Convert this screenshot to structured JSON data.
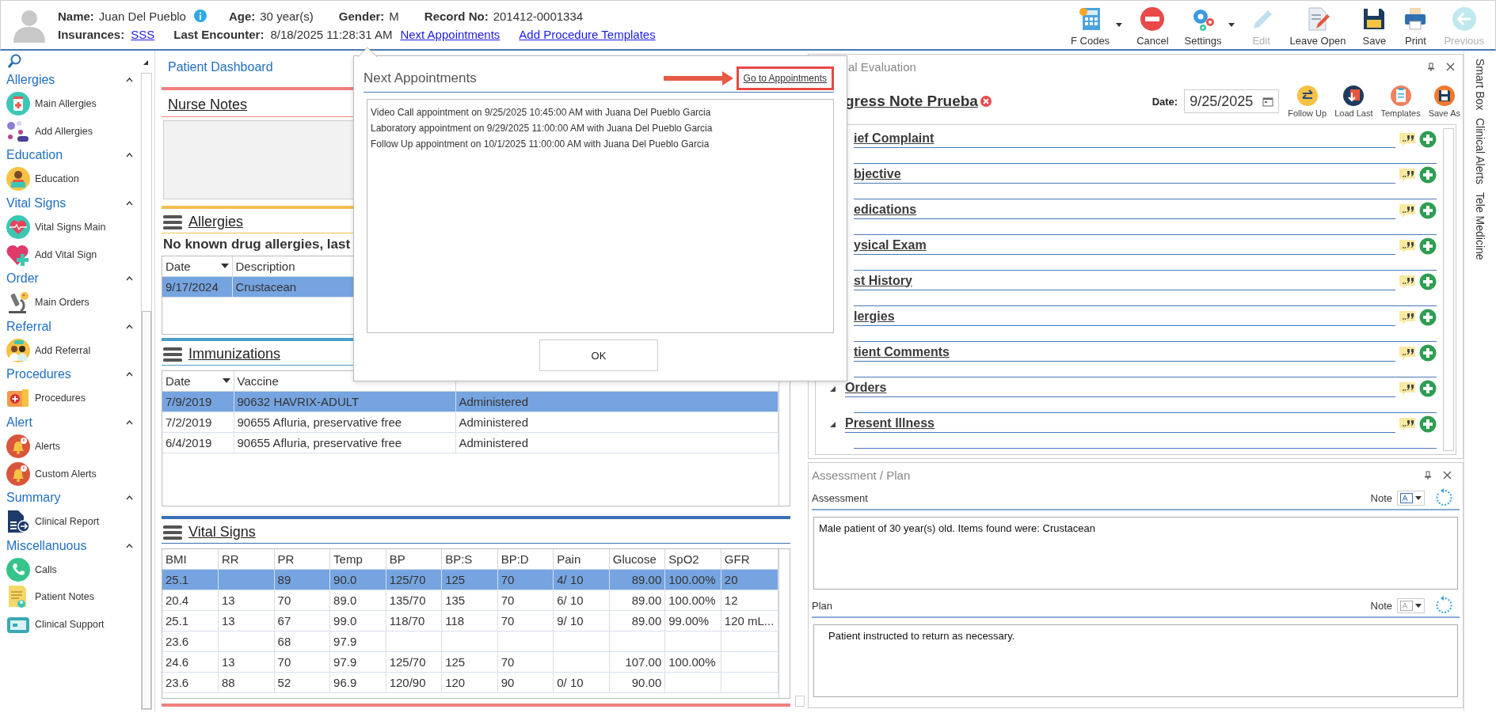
{
  "header": {
    "fields": [
      {
        "label": "Name:",
        "value": "Juan Del Pueblo"
      },
      {
        "label": "Age:",
        "value": "30 year(s)"
      },
      {
        "label": "Gender:",
        "value": "M"
      },
      {
        "label": "Record No:",
        "value": "201412-0001334"
      }
    ],
    "line2": [
      {
        "kind": "label",
        "text": "Insurances:"
      },
      {
        "kind": "link",
        "text": "SSS"
      },
      {
        "kind": "label",
        "text": "Last Encounter:"
      },
      {
        "kind": "value",
        "text": "8/18/2025 11:28:31 AM"
      },
      {
        "kind": "link",
        "text": "Next Appointments"
      },
      {
        "kind": "link",
        "text": "Add Procedure Templates"
      }
    ]
  },
  "toolbar": [
    {
      "label": "F Codes",
      "dropdown": true,
      "disabled": false
    },
    {
      "label": "Cancel",
      "dropdown": false,
      "disabled": false
    },
    {
      "label": "Settings",
      "dropdown": true,
      "disabled": false
    },
    {
      "label": "Edit",
      "dropdown": false,
      "disabled": true
    },
    {
      "label": "Leave Open",
      "dropdown": false,
      "disabled": false
    },
    {
      "label": "Save",
      "dropdown": false,
      "disabled": false
    },
    {
      "label": "Print",
      "dropdown": false,
      "disabled": false
    },
    {
      "label": "Previous",
      "dropdown": false,
      "disabled": true
    }
  ],
  "sidebar": {
    "groups": [
      {
        "title": "Allergies",
        "expanded": true,
        "items": [
          "Main Allergies",
          "Add Allergies"
        ]
      },
      {
        "title": "Education",
        "expanded": true,
        "items": [
          "Education"
        ]
      },
      {
        "title": "Vital Signs",
        "expanded": true,
        "items": [
          "Vital Signs Main",
          "Add Vital Sign"
        ]
      },
      {
        "title": "Order",
        "expanded": true,
        "items": [
          "Main Orders"
        ]
      },
      {
        "title": "Referral",
        "expanded": true,
        "items": [
          "Add Referral"
        ]
      },
      {
        "title": "Procedures",
        "expanded": true,
        "items": [
          "Procedures"
        ]
      },
      {
        "title": "Alert",
        "expanded": true,
        "items": [
          "Alerts",
          "Custom Alerts"
        ]
      },
      {
        "title": "Summary",
        "expanded": true,
        "items": [
          "Clinical Report"
        ]
      },
      {
        "title": "Miscellanuous",
        "expanded": true,
        "items": [
          "Calls",
          "Patient Notes",
          "Clinical Support"
        ]
      }
    ]
  },
  "dashboard": {
    "title": "Patient Dashboard",
    "nurse_notes": {
      "title": "Nurse Notes"
    },
    "allergies": {
      "title": "Allergies",
      "summary": "No known drug allergies, last",
      "columns": [
        {
          "label": "Date",
          "filter": true
        },
        {
          "label": "Description",
          "filter": false
        }
      ],
      "rows": [
        {
          "cells": [
            "9/17/2024",
            "Crustacean"
          ],
          "selected": true
        }
      ]
    },
    "immunizations": {
      "title": "Immunizations",
      "columns": [
        {
          "label": "Date",
          "filter": true
        },
        {
          "label": "Vaccine",
          "filter": false
        }
      ],
      "rows": [
        {
          "cells": [
            "7/9/2019",
            "90632 HAVRIX-ADULT",
            "Administered"
          ],
          "selected": true
        },
        {
          "cells": [
            "7/2/2019",
            "90655 Afluria, preservative free",
            "Administered"
          ],
          "selected": false
        },
        {
          "cells": [
            "6/4/2019",
            "90655 Afluria, preservative free",
            "Administered"
          ],
          "selected": false
        }
      ]
    },
    "vital_signs": {
      "title": "Vital Signs",
      "columns": [
        "BMI",
        "RR",
        "PR",
        "Temp",
        "BP",
        "BP:S",
        "BP:D",
        "Pain",
        "Glucose",
        "SpO2",
        "GFR"
      ],
      "rows": [
        {
          "cells": [
            "25.1",
            "",
            "89",
            "90.0",
            "125/70",
            "125",
            "70",
            "4/ 10",
            "89.00",
            "100.00%",
            "20"
          ],
          "selected": true
        },
        {
          "cells": [
            "20.4",
            "13",
            "70",
            "89.0",
            "135/70",
            "135",
            "70",
            "6/ 10",
            "89.00",
            "100.00%",
            "12"
          ],
          "selected": false
        },
        {
          "cells": [
            "25.1",
            "13",
            "67",
            "99.0",
            "118/70",
            "118",
            "70",
            "9/ 10",
            "89.00",
            "99.00%",
            "120 mL..."
          ],
          "selected": false
        },
        {
          "cells": [
            "23.6",
            "",
            "68",
            "97.9",
            "",
            "",
            "",
            "",
            "",
            "",
            ""
          ],
          "selected": false
        },
        {
          "cells": [
            "24.6",
            "13",
            "70",
            "97.9",
            "125/70",
            "125",
            "70",
            "",
            "107.00",
            "100.00%",
            ""
          ],
          "selected": false
        },
        {
          "cells": [
            "23.6",
            "88",
            "52",
            "96.9",
            "120/90",
            "120",
            "90",
            "0/ 10",
            "90.00",
            "",
            ""
          ],
          "selected": false
        }
      ]
    }
  },
  "popup": {
    "title": "Next Appointments",
    "link": "Go to Appointments",
    "items": [
      "Video Call appointment on 9/25/2025 10:45:00 AM with Juana Del Pueblo Garcia",
      "Laboratory appointment on 9/29/2025 11:00:00 AM with Juana Del Pueblo Garcia",
      "Follow Up appointment on 10/1/2025 11:00:00 AM with Juana Del Pueblo Garcia"
    ],
    "button": "OK"
  },
  "evaluation": {
    "title": "al Evaluation",
    "note_title": "gress Note Prueba",
    "date_label": "Date:",
    "date": "9/25/2025",
    "actions": [
      "Follow Up",
      "Load Last",
      "Templates",
      "Save As"
    ],
    "sections": [
      {
        "title": "ief Complaint",
        "covered": true
      },
      {
        "title": "bjective",
        "covered": true
      },
      {
        "title": "edications",
        "covered": true
      },
      {
        "title": "ysical Exam",
        "covered": true
      },
      {
        "title": "st History",
        "covered": true
      },
      {
        "title": "lergies",
        "covered": true
      },
      {
        "title": "tient Comments",
        "covered": true
      },
      {
        "title": "Orders",
        "covered": false
      },
      {
        "title": "Present Illness",
        "covered": false
      }
    ]
  },
  "assessment_plan": {
    "title": "Assessment / Plan",
    "parts": [
      {
        "label": "Assessment",
        "note_label": "Note",
        "note_disabled": false,
        "text": "Male patient of 30 year(s) old. Items found were:  Crustacean"
      },
      {
        "label": "Plan",
        "note_label": "Note",
        "note_disabled": true,
        "text": "Patient instructed to return as necessary."
      }
    ]
  },
  "side_tabs": [
    "Smart Box",
    "Clinical Alerts",
    "Tele Medicine"
  ]
}
